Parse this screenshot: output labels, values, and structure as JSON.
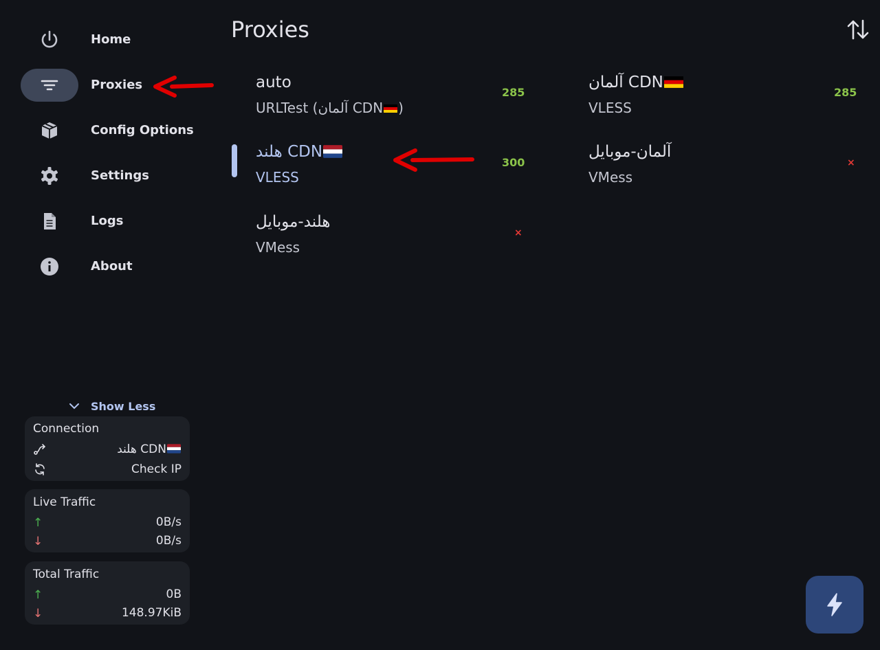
{
  "sidebar": {
    "items": [
      {
        "label": "Home",
        "icon": "power-icon"
      },
      {
        "label": "Proxies",
        "icon": "filter-list-icon",
        "active": true
      },
      {
        "label": "Config Options",
        "icon": "package-icon"
      },
      {
        "label": "Settings",
        "icon": "gear-icon"
      },
      {
        "label": "Logs",
        "icon": "document-icon"
      },
      {
        "label": "About",
        "icon": "info-icon"
      }
    ],
    "show_less_label": "Show Less",
    "connection": {
      "title": "Connection",
      "proxy_name": "هلند CDN",
      "check_ip_label": "Check IP"
    },
    "live_traffic": {
      "title": "Live Traffic",
      "upload": "0B/s",
      "download": "0B/s"
    },
    "total_traffic": {
      "title": "Total Traffic",
      "upload": "0B",
      "download": "148.97KiB"
    }
  },
  "main": {
    "title": "Proxies",
    "proxies": [
      {
        "name": "auto",
        "type": "URLTest (آلمان CDN",
        "type_suffix": ")",
        "delay": "285"
      },
      {
        "name": "آلمان CDN",
        "type": "VLESS",
        "delay": "285"
      },
      {
        "name": "هلند CDN",
        "type": "VLESS",
        "delay": "300",
        "selected": true
      },
      {
        "name": "آلمان-موبایل",
        "type": "VMess",
        "status": "×"
      },
      {
        "name": "هلند-موبایل",
        "type": "VMess",
        "status": "×"
      }
    ]
  },
  "colors": {
    "background": "#111318",
    "accent": "#b3c5f0",
    "delay_good": "#8bc34a",
    "fail": "#e53935",
    "fab": "#2d4679"
  }
}
